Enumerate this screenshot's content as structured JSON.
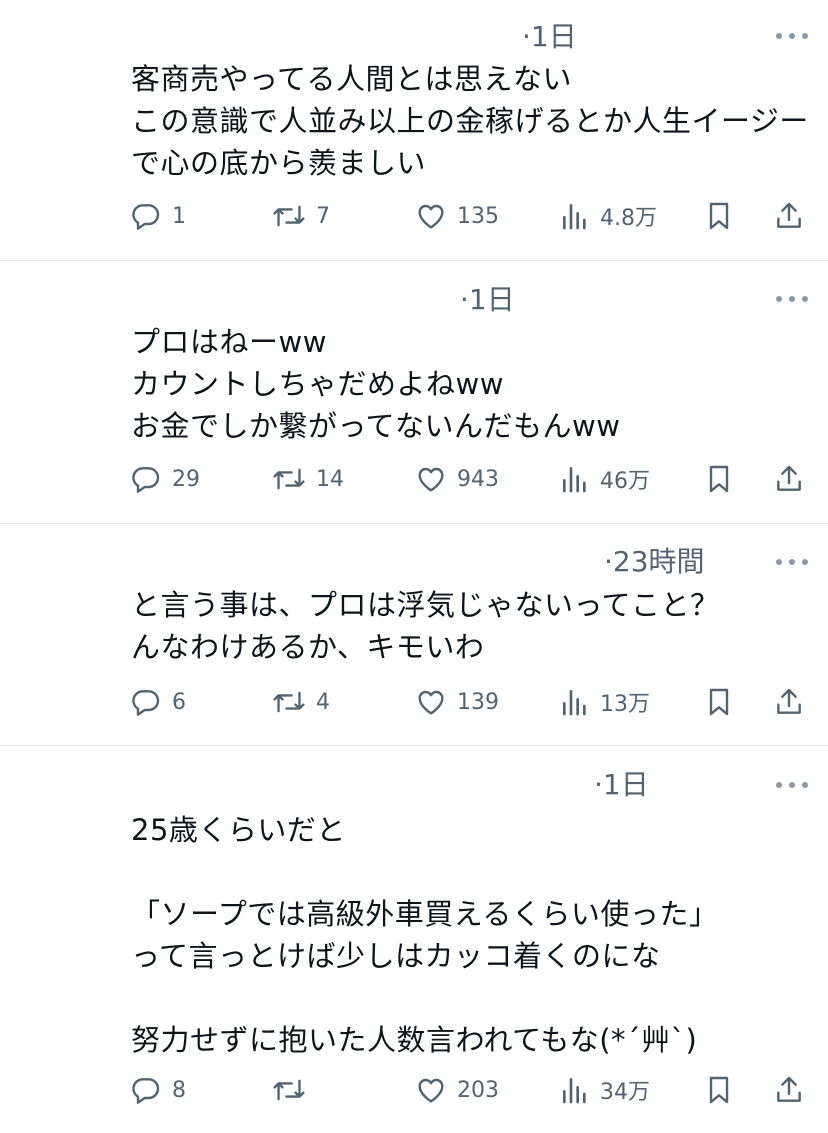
{
  "posts": [
    {
      "time": "·1日",
      "text": "客商売やってる人間とは思えない\nこの意識で人並み以上の金稼げるとか人生イージーで心の底から羨ましい",
      "replies": "1",
      "reposts": "7",
      "likes": "135",
      "views": "4.8万"
    },
    {
      "time": "·1日",
      "text": "プロはねーww\nカウントしちゃだめよねww\nお金でしか繋がってないんだもんww",
      "replies": "29",
      "reposts": "14",
      "likes": "943",
      "views": "46万"
    },
    {
      "time": "·23時間",
      "text": "と言う事は、プロは浮気じゃないってこと？\nんなわけあるか、キモいわ",
      "replies": "6",
      "reposts": "4",
      "likes": "139",
      "views": "13万"
    },
    {
      "time": "·1日",
      "text": "25歳くらいだと\n\n「ソープでは高級外車買えるくらい使った」\nって言っとけば少しはカッコ着くのにな\n\n努力せずに抱いた人数言われてもな(*´艸`)",
      "replies": "8",
      "reposts": "",
      "likes": "203",
      "views": "34万"
    }
  ],
  "icons": {
    "reply": "reply-icon",
    "repost": "repost-icon",
    "like": "heart-icon",
    "views": "views-icon",
    "bookmark": "bookmark-icon",
    "share": "share-icon",
    "more": "more-icon"
  },
  "colors": {
    "text": "#0f1419",
    "secondary": "#536471",
    "divider": "#e6e9ec"
  }
}
